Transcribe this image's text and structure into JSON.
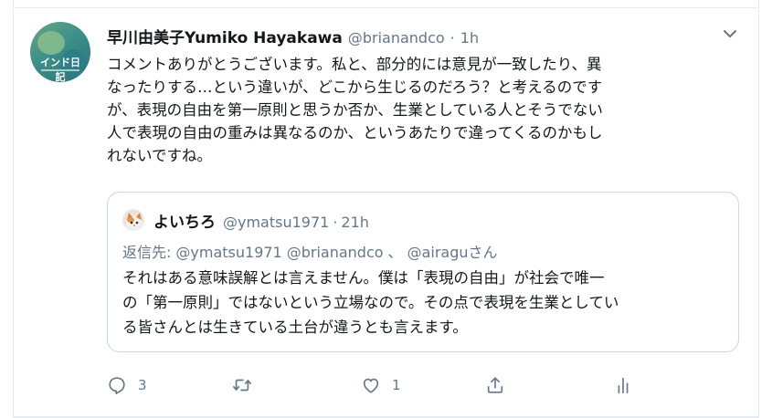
{
  "tweet": {
    "author_name": "早川由美子Yumiko Hayakawa",
    "author_handle": "@brianandco",
    "separator": "·",
    "time": "1h",
    "avatar_text": "インド日記",
    "text_lines": [
      "コメントありがとうございます。私と、部分的には意見が一致したり、異",
      "なったりする…という違いが、どこから生じるのだろう？と考えるのです",
      "が、表現の自由を第一原則と思うか否か、生業としている人とそうでない",
      "人で表現の自由の重みは異なるのか、というあたりで違ってくるのかもし",
      "れないですね。"
    ]
  },
  "quoted": {
    "author_name": "よいちろ",
    "author_handle": "@ymatsu1971",
    "separator": "·",
    "time": "21h",
    "reply_prefix": "返信先:",
    "reply_handles": [
      "@ymatsu1971",
      "@brianandco",
      "、",
      "@airagu"
    ],
    "reply_suffix": "さん",
    "text_lines": [
      "それはある意味誤解とは言えません。僕は「表現の自由」が社会で唯一",
      "の「第一原則」ではないという立場なので。その点で表現を生業としてい",
      "る皆さんとは生きている土台が違うとも言えます。"
    ]
  },
  "actions": {
    "reply_count": "3",
    "retweet_count": "",
    "like_count": "1",
    "icons": [
      "reply-icon",
      "retweet-icon",
      "like-icon",
      "share-icon",
      "analytics-icon"
    ]
  },
  "colors": {
    "secondary_text": "#657786",
    "border": "#ccd6dd",
    "primary_text": "#14171a"
  }
}
